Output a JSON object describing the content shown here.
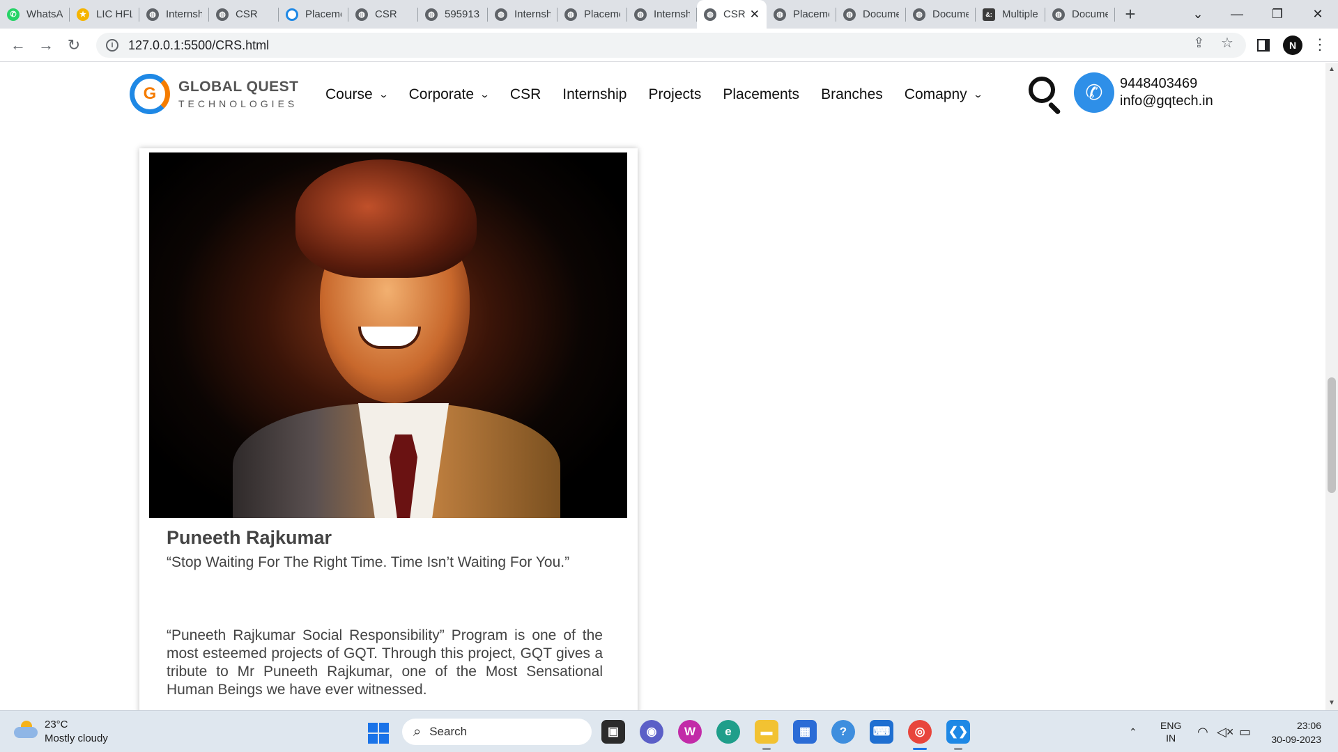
{
  "browser": {
    "tabs": [
      {
        "label": "WhatsApp",
        "favicon": "whatsapp-icon",
        "active": false
      },
      {
        "label": "LIC HFL",
        "favicon": "lic-icon",
        "active": false
      },
      {
        "label": "Internship",
        "favicon": "globe-icon",
        "active": false
      },
      {
        "label": "CSR",
        "favicon": "globe-icon",
        "active": false
      },
      {
        "label": "Placements",
        "favicon": "gq-icon",
        "active": false
      },
      {
        "label": "CSR",
        "favicon": "globe-icon",
        "active": false
      },
      {
        "label": "595913",
        "favicon": "globe-icon",
        "active": false
      },
      {
        "label": "Internship",
        "favicon": "globe-icon",
        "active": false
      },
      {
        "label": "Placements",
        "favicon": "globe-icon",
        "active": false
      },
      {
        "label": "Internship",
        "favicon": "globe-icon",
        "active": false
      },
      {
        "label": "CSR",
        "favicon": "globe-icon",
        "active": true
      },
      {
        "label": "Placements",
        "favicon": "globe-icon",
        "active": false
      },
      {
        "label": "Document",
        "favicon": "globe-icon",
        "active": false
      },
      {
        "label": "Document",
        "favicon": "globe-icon",
        "active": false
      },
      {
        "label": "Multiple",
        "favicon": "multiple-icon",
        "active": false
      },
      {
        "label": "Document",
        "favicon": "globe-icon",
        "active": false
      }
    ],
    "url": "127.0.0.1:5500/CRS.html",
    "profile_initial": "N"
  },
  "site": {
    "logo": {
      "title": "GLOBAL QUEST",
      "subtitle": "TECHNOLOGIES",
      "mark": "G"
    },
    "nav": [
      {
        "label": "Course",
        "dropdown": true
      },
      {
        "label": "Corporate",
        "dropdown": true
      },
      {
        "label": "CSR",
        "dropdown": false
      },
      {
        "label": "Internship",
        "dropdown": false
      },
      {
        "label": "Projects",
        "dropdown": false
      },
      {
        "label": "Placements",
        "dropdown": false
      },
      {
        "label": "Branches",
        "dropdown": false
      },
      {
        "label": "Comapny",
        "dropdown": true
      }
    ],
    "contact": {
      "phone": "9448403469",
      "email": "info@gqtech.in"
    },
    "accent_color": "#2e8fe8"
  },
  "card": {
    "name": "Puneeth Rajkumar",
    "quote": "“Stop Waiting For The Right Time. Time Isn’t Waiting For You.”",
    "description": "“Puneeth Rajkumar Social Responsibility” Program is one of the most esteemed projects of GQT. Through this project, GQT gives a tribute to Mr Puneeth Rajkumar, one of the Most Sensational Human Beings we have ever witnessed."
  },
  "taskbar": {
    "weather": {
      "temp": "23°C",
      "condition": "Mostly cloudy"
    },
    "search_label": "Search",
    "language": {
      "line1": "ENG",
      "line2": "IN"
    },
    "time": "23:06",
    "date": "30-09-2023"
  }
}
